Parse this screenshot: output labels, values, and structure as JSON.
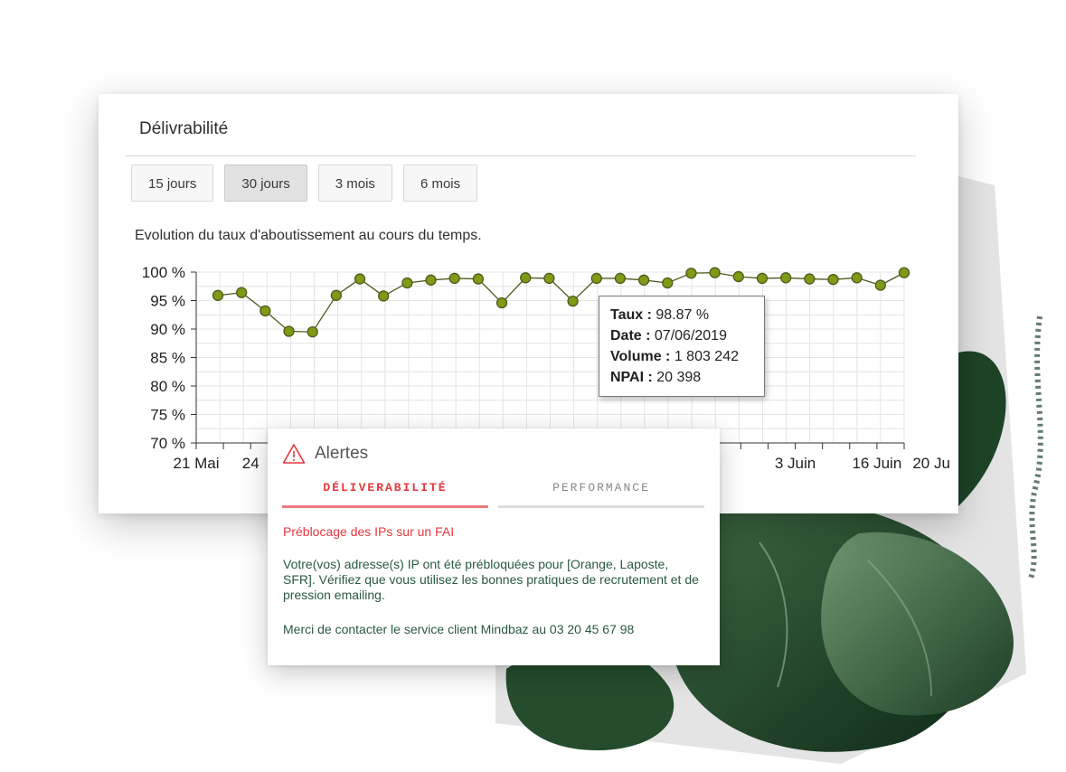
{
  "card": {
    "title": "Délivrabilité",
    "ranges": [
      {
        "label": "15 jours",
        "active": false
      },
      {
        "label": "30 jours",
        "active": true
      },
      {
        "label": "3 mois",
        "active": false
      },
      {
        "label": "6 mois",
        "active": false
      }
    ],
    "description": "Evolution du taux d'aboutissement au cours du temps."
  },
  "chart_data": {
    "type": "line",
    "title": "",
    "xlabel": "",
    "ylabel": "",
    "ylim": [
      70,
      100
    ],
    "yticks": [
      "70 %",
      "75 %",
      "80 %",
      "85 %",
      "90 %",
      "95 %",
      "100 %"
    ],
    "xtick_labels": [
      "21 Mai",
      "24",
      "3 Juin",
      "16 Juin",
      "20 Ju"
    ],
    "grid": true,
    "series": [
      {
        "color": "#7e9a16",
        "values": [
          95.9,
          96.4,
          93.2,
          89.6,
          89.5,
          95.9,
          98.8,
          95.8,
          98.1,
          98.6,
          98.9,
          98.8,
          94.6,
          99.0,
          98.9,
          94.9,
          98.9,
          98.9,
          98.6,
          98.1,
          99.8,
          99.9,
          99.2,
          98.9,
          99.0,
          98.8,
          98.7,
          99.0,
          97.7,
          99.9
        ]
      }
    ]
  },
  "tooltip": {
    "taux_label": "Taux :",
    "taux_value": " 98.87 %",
    "date_label": "Date :",
    "date_value": " 07/06/2019",
    "volume_label": "Volume :",
    "volume_value": " 1 803 242",
    "npai_label": "NPAI :",
    "npai_value": " 20 398"
  },
  "alerts": {
    "title": "Alertes",
    "tabs": [
      "DÉLIVERABILITÉ",
      "PERFORMANCE"
    ],
    "alert_title": "Préblocage des IPs sur un FAI",
    "alert_body": "Votre(vos) adresse(s) IP ont été prébloquées pour [Orange, Laposte, SFR]. Vérifiez que vous utilisez les bonnes pratiques de recrutement et de pression emailing.",
    "contact": "Merci de contacter le service client Mindbaz au 03 20 45 67 98"
  },
  "colors": {
    "accent_red": "#e4373d",
    "series_green": "#7e9a16",
    "body_green": "#2a5a41"
  }
}
